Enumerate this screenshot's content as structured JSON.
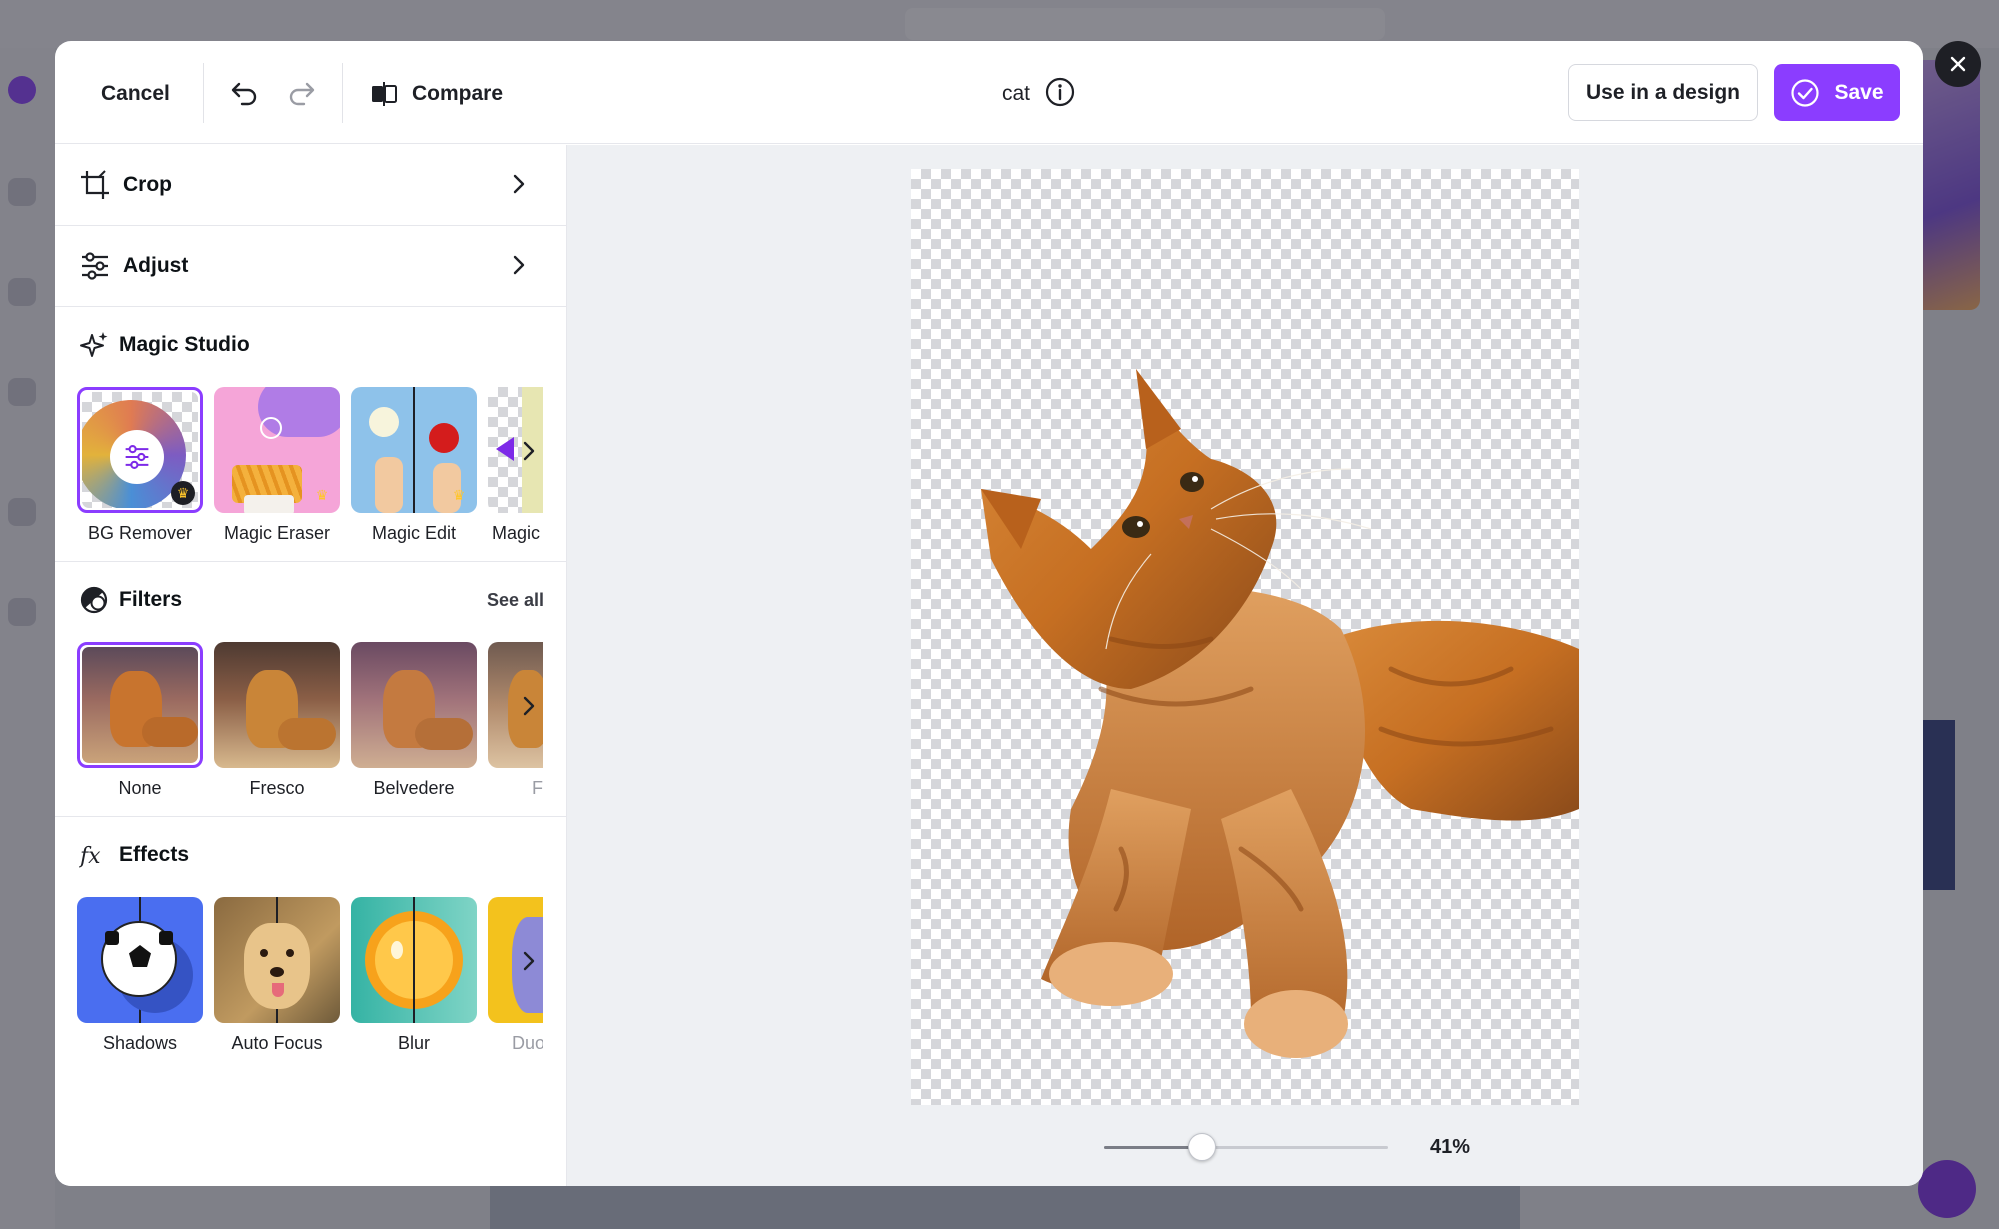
{
  "toolbar": {
    "cancel_label": "Cancel",
    "compare_label": "Compare",
    "title": "cat",
    "use_in_design_label": "Use in a design",
    "save_label": "Save"
  },
  "panel": {
    "crop_label": "Crop",
    "adjust_label": "Adjust",
    "magic_studio": {
      "heading": "Magic Studio",
      "items": [
        {
          "label": "BG Remover",
          "premium": true,
          "selected": true
        },
        {
          "label": "Magic Eraser",
          "premium": true
        },
        {
          "label": "Magic Edit",
          "premium": true
        },
        {
          "label": "Magic"
        }
      ]
    },
    "filters": {
      "heading": "Filters",
      "see_all_label": "See all",
      "items": [
        {
          "label": "None",
          "selected": true
        },
        {
          "label": "Fresco"
        },
        {
          "label": "Belvedere"
        },
        {
          "label": "F"
        }
      ]
    },
    "effects": {
      "heading": "Effects",
      "items": [
        {
          "label": "Shadows"
        },
        {
          "label": "Auto Focus"
        },
        {
          "label": "Blur"
        },
        {
          "label": "Duo"
        }
      ]
    }
  },
  "canvas": {
    "zoom_percent": 41,
    "zoom_label": "41%"
  },
  "colors": {
    "accent": "#8b3dff",
    "canvas_bg": "#eef0f3",
    "close_button": "#1e1f25"
  },
  "icons": [
    "close-icon",
    "undo-icon",
    "redo-icon",
    "compare-icon",
    "info-icon",
    "check-circle-icon",
    "crop-icon",
    "sliders-icon",
    "sparkle-icon",
    "filters-icon",
    "fx-icon",
    "chevron-right-icon",
    "crown-icon"
  ]
}
